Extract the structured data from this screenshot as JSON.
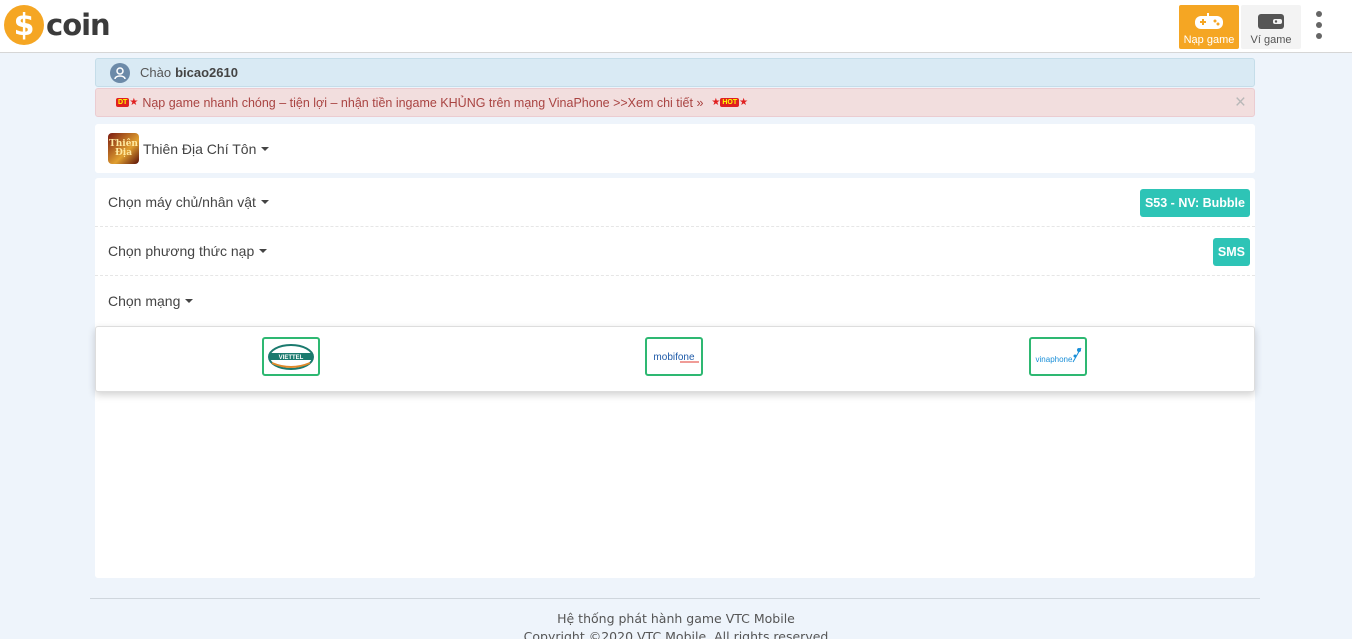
{
  "header": {
    "logo_symbol": "$",
    "logo_text": "coin",
    "nap_game_label": "Nạp game",
    "vi_game_label": "Ví game",
    "accent_color": "#f5a623"
  },
  "greeting": {
    "prefix": "Chào",
    "username": "bicao2610"
  },
  "alert": {
    "badge": "DT",
    "text": "Nạp game nhanh chóng – tiện lợi – nhận tiền ingame KHỦNG trên mạng VinaPhone >>Xem chi tiết »",
    "hot_badge": "HOT",
    "close": "×"
  },
  "game": {
    "thumb_text": "Thiên Địa",
    "name": "Thiên Địa Chí Tôn"
  },
  "rows": {
    "server": {
      "label": "Chọn máy chủ/nhân vật",
      "value": "S53 - NV: Bubble"
    },
    "method": {
      "label": "Chọn phương thức nạp",
      "value": "SMS"
    },
    "network": {
      "label": "Chọn mạng"
    }
  },
  "networks": [
    {
      "name": "VIETTEL",
      "color": "#1b7a6e"
    },
    {
      "name": "mobifone",
      "color": "#1e5aa8"
    },
    {
      "name": "vinaphone",
      "color": "#1a8fd8"
    }
  ],
  "footer": {
    "line1": "Hệ thống phát hành game VTC Mobile",
    "line2": "Copyright ©2020 VTC Mobile. All rights reserved"
  },
  "colors": {
    "tag_bg": "#2ec4b6",
    "network_border": "#2eb872"
  }
}
